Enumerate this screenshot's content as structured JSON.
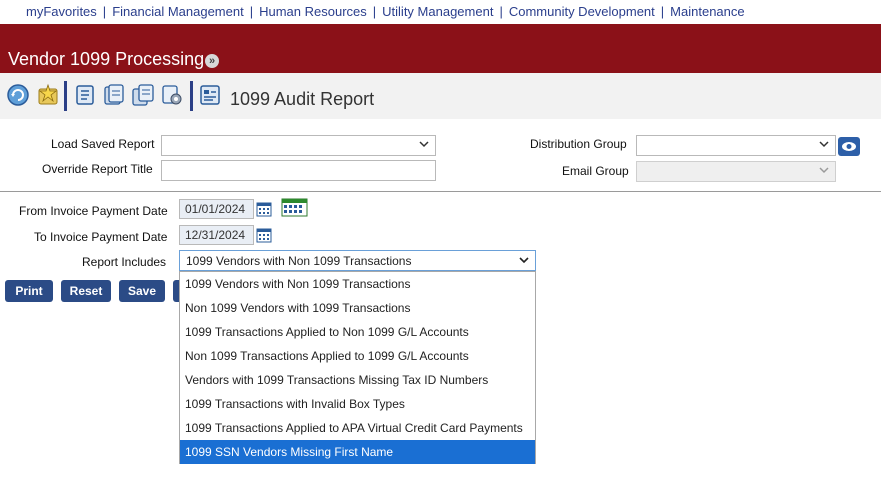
{
  "nav": {
    "items": [
      "myFavorites",
      "Financial Management",
      "Human Resources",
      "Utility Management",
      "Community Development",
      "Maintenance"
    ],
    "separator": "|"
  },
  "banner": {
    "title": "Vendor 1099 Processing",
    "chevron": "»"
  },
  "toolbar": {
    "report_title": "1099 Audit Report",
    "icons": [
      "refresh-icon",
      "favorites-icon",
      "list-icon",
      "report-icon",
      "documents-icon",
      "settings-icon",
      "audit-icon"
    ]
  },
  "form": {
    "load_saved_report_label": "Load Saved Report",
    "override_title_label": "Override Report Title",
    "distribution_group_label": "Distribution Group",
    "email_group_label": "Email Group",
    "from_date_label": "From Invoice Payment Date",
    "from_date_value": "01/01/2024",
    "to_date_label": "To Invoice Payment Date",
    "to_date_value": "12/31/2024",
    "report_includes_label": "Report Includes",
    "report_includes_value": "1099 Vendors with Non 1099 Transactions"
  },
  "buttons": {
    "print": "Print",
    "reset": "Reset",
    "save": "Save"
  },
  "dropdown": {
    "options": [
      "1099 Vendors with Non 1099 Transactions",
      "Non 1099 Vendors with 1099 Transactions",
      "1099 Transactions Applied to Non 1099 G/L Accounts",
      "Non 1099 Transactions Applied to 1099 G/L Accounts",
      "Vendors with 1099 Transactions Missing Tax ID Numbers",
      "1099 Transactions with Invalid Box Types",
      "1099 Transactions Applied to APA Virtual Credit Card Payments",
      "1099 SSN Vendors Missing First Name"
    ],
    "highlighted_index": 7
  },
  "colors": {
    "banner": "#8b1118",
    "nav_link": "#2a3e8c",
    "button": "#2b4b86",
    "highlight": "#1a6fd3"
  }
}
